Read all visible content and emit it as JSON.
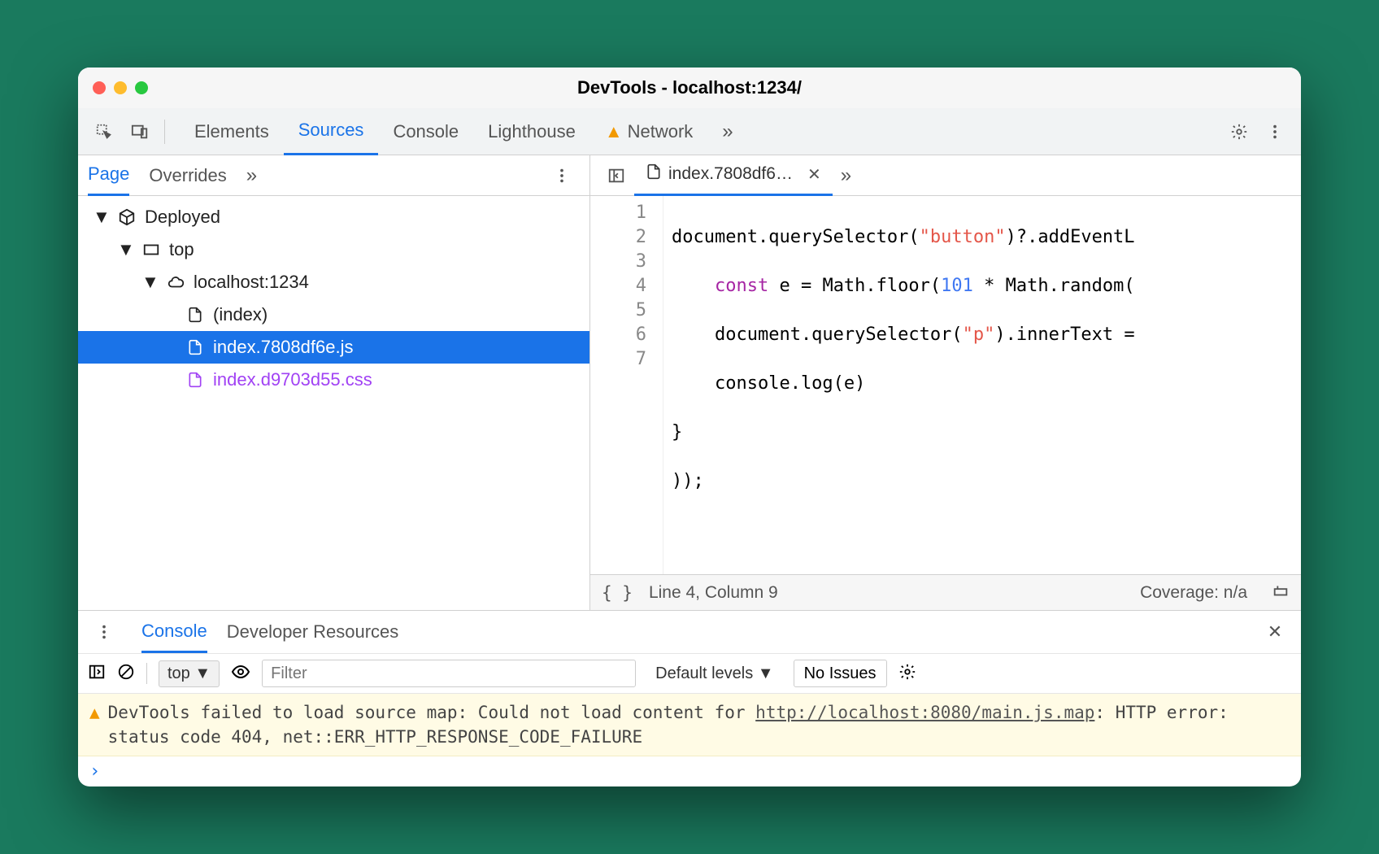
{
  "window": {
    "title": "DevTools - localhost:1234/"
  },
  "main_tabs": {
    "elements": "Elements",
    "sources": "Sources",
    "console": "Console",
    "lighthouse": "Lighthouse",
    "network": "Network"
  },
  "sidebar": {
    "tabs": {
      "page": "Page",
      "overrides": "Overrides"
    },
    "tree": {
      "deployed": "Deployed",
      "top": "top",
      "host": "localhost:1234",
      "index": "(index)",
      "js": "index.7808df6e.js",
      "css": "index.d9703d55.css"
    }
  },
  "editor": {
    "tab_label": "index.7808df6…",
    "line_numbers": [
      "1",
      "2",
      "3",
      "4",
      "5",
      "6",
      "7"
    ],
    "l1": {
      "a": "document.querySelector(",
      "b": "\"button\"",
      "c": ")?.addEventL"
    },
    "l2": {
      "a": "    ",
      "kw": "const",
      "b": " e = Math.floor(",
      "num": "101",
      "c": " * Math.random("
    },
    "l3": {
      "a": "    document.querySelector(",
      "b": "\"p\"",
      "c": ").innerText ="
    },
    "l4": "    console.log(e)",
    "l5": "}",
    "l6": "));"
  },
  "statusbar": {
    "position": "Line 4, Column 9",
    "coverage": "Coverage: n/a"
  },
  "drawer": {
    "tabs": {
      "console": "Console",
      "dev_resources": "Developer Resources"
    },
    "context_dropdown": "top",
    "filter_placeholder": "Filter",
    "levels": "Default levels",
    "no_issues": "No Issues",
    "warning": {
      "prefix": "DevTools failed to load source map: Could not load content for ",
      "link": "http://localhost:8080/main.js.map",
      "suffix": ": HTTP error: status code 404, net::ERR_HTTP_RESPONSE_CODE_FAILURE"
    }
  }
}
